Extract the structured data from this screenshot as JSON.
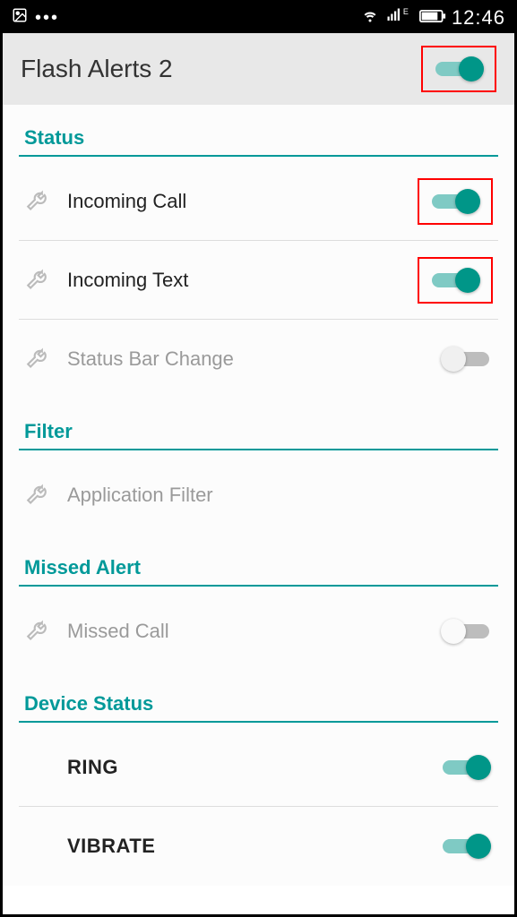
{
  "statusbar": {
    "time": "12:46"
  },
  "appbar": {
    "title": "Flash Alerts 2",
    "main_toggle": true
  },
  "sections": {
    "status": {
      "title": "Status",
      "items": [
        {
          "label": "Incoming Call",
          "toggle": true,
          "highlighted": true
        },
        {
          "label": "Incoming Text",
          "toggle": true,
          "highlighted": true
        },
        {
          "label": "Status Bar Change",
          "toggle": false,
          "disabled": true
        }
      ]
    },
    "filter": {
      "title": "Filter",
      "items": [
        {
          "label": "Application Filter",
          "disabled": true
        }
      ]
    },
    "missed": {
      "title": "Missed Alert",
      "items": [
        {
          "label": "Missed Call",
          "toggle": false,
          "disabled": true
        }
      ]
    },
    "device": {
      "title": "Device Status",
      "items": [
        {
          "label": "RING",
          "toggle": true
        },
        {
          "label": "VIBRATE",
          "toggle": true
        }
      ]
    }
  }
}
